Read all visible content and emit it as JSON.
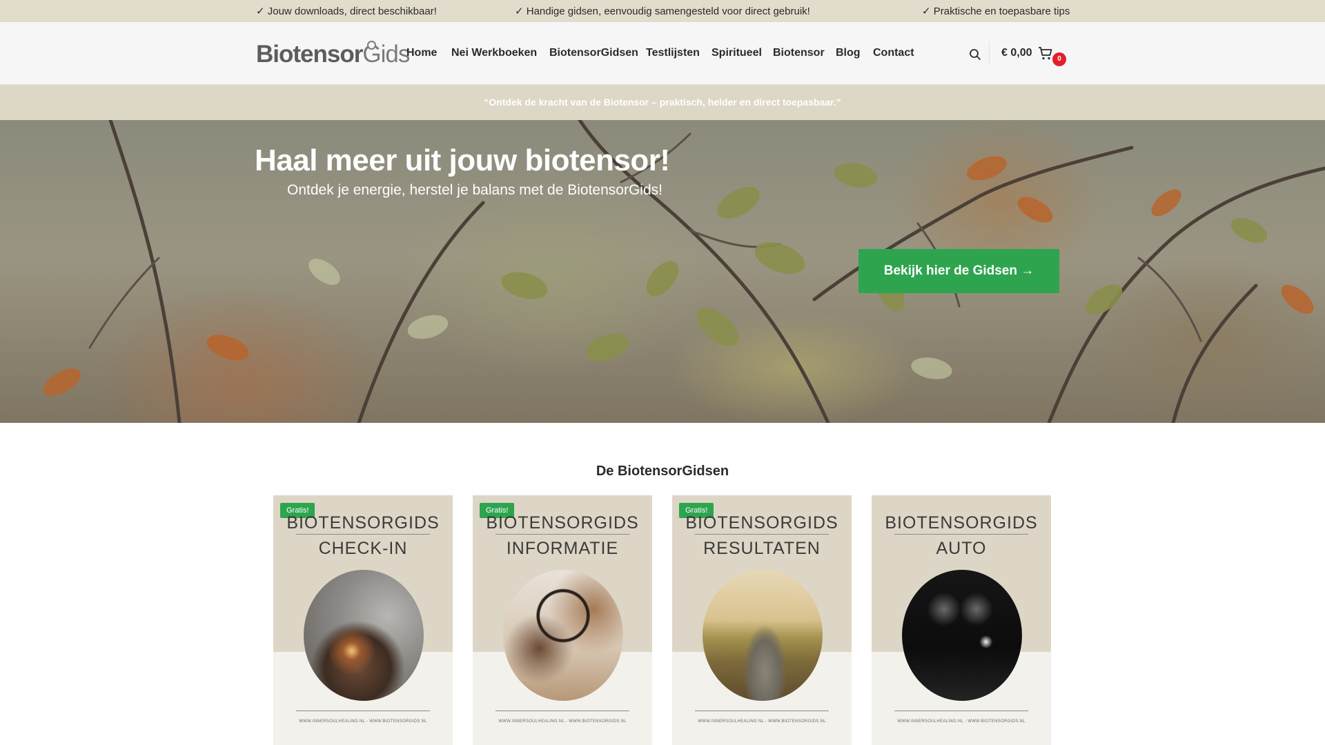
{
  "topbar": {
    "items": [
      "✓ Jouw downloads, direct beschikbaar!",
      "✓ Handige gidsen, eenvoudig samengesteld voor direct gebruik!",
      "✓ Praktische en toepasbare tips"
    ]
  },
  "header": {
    "logo_bold": "Biotensor",
    "logo_light": "Gids",
    "nav": [
      "Home",
      "Nei Werkboeken",
      "BiotensorGidsen",
      "Testlijsten",
      "Spiritueel",
      "Biotensor",
      "Blog",
      "Contact"
    ],
    "cart_total": "€ 0,00",
    "cart_count": "0",
    "icons": {
      "search": "search-icon",
      "cart": "cart-icon"
    }
  },
  "tagline": "“Ontdek de kracht van de Biotensor – praktisch, helder en direct toepasbaar.”",
  "hero": {
    "title": "Haal meer uit jouw biotensor!",
    "subtitle": "Ontdek je energie, herstel je balans met de BiotensorGids!",
    "button": "Bekijk hier de Gidsen →"
  },
  "section": {
    "title": "De BiotensorGidsen",
    "cards": [
      {
        "badge": "Gratis!",
        "title1": "BIOTENSORGIDS",
        "title2": "CHECK-IN",
        "footer": "WWW.INNERSOULHEALING.NL - WWW.BIOTENSORGIDS.NL"
      },
      {
        "badge": "Gratis!",
        "title1": "BIOTENSORGIDS",
        "title2": "INFORMATIE",
        "footer": "WWW.INNERSOULHEALING.NL - WWW.BIOTENSORGIDS.NL"
      },
      {
        "badge": "Gratis!",
        "title1": "BIOTENSORGIDS",
        "title2": "RESULTATEN",
        "footer": "WWW.INNERSOULHEALING.NL - WWW.BIOTENSORGIDS.NL"
      },
      {
        "badge": "",
        "title1": "BIOTENSORGIDS",
        "title2": "AUTO",
        "footer": "WWW.INNERSOULHEALING.NL - WWW.BIOTENSORGIDS.NL"
      }
    ]
  },
  "colors": {
    "accent_green": "#2ea44f",
    "beige": "#ddd7c6",
    "badge_red": "#e21f2b"
  }
}
